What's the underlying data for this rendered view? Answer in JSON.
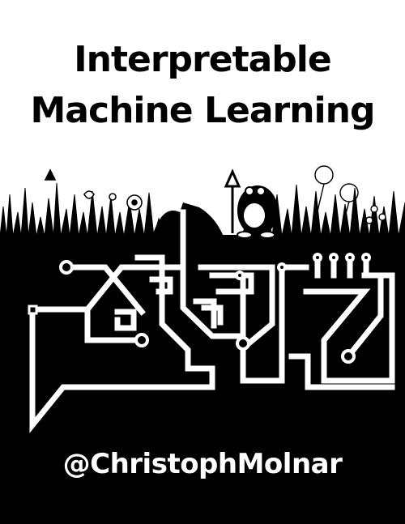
{
  "cover": {
    "title_line1": "Interpretable",
    "title_line2": "Machine Learning",
    "author_handle": "@ChristophMolnar"
  },
  "colors": {
    "background": "#ffffff",
    "ground": "#000000",
    "circuit": "#ffffff"
  },
  "illustration": {
    "icons": [
      "grass-icon",
      "flower-icon",
      "dandelion-icon",
      "mole-icon",
      "shovel-icon",
      "circuit-icon"
    ]
  }
}
